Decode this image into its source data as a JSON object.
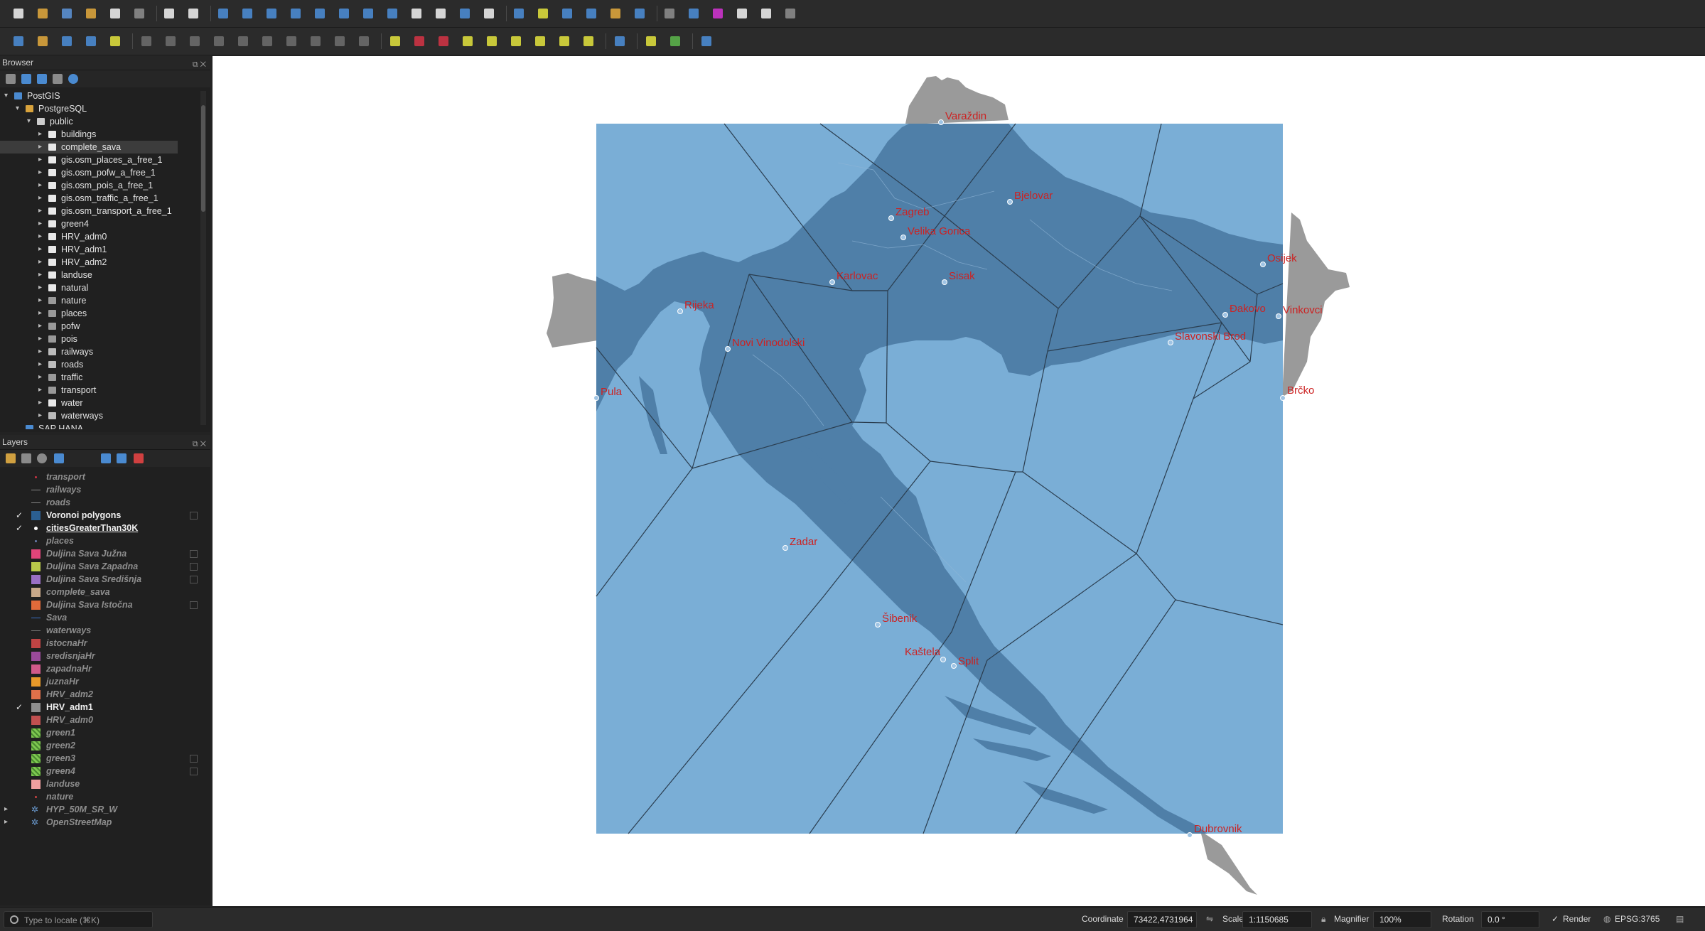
{
  "browser": {
    "title": "Browser",
    "items": [
      {
        "label": "PostGIS"
      },
      {
        "label": "PostgreSQL"
      },
      {
        "label": "public"
      },
      {
        "label": "buildings"
      },
      {
        "label": "complete_sava"
      },
      {
        "label": "gis.osm_places_a_free_1"
      },
      {
        "label": "gis.osm_pofw_a_free_1"
      },
      {
        "label": "gis.osm_pois_a_free_1"
      },
      {
        "label": "gis.osm_traffic_a_free_1"
      },
      {
        "label": "gis.osm_transport_a_free_1"
      },
      {
        "label": "green4"
      },
      {
        "label": "HRV_adm0"
      },
      {
        "label": "HRV_adm1"
      },
      {
        "label": "HRV_adm2"
      },
      {
        "label": "landuse"
      },
      {
        "label": "natural"
      },
      {
        "label": "nature"
      },
      {
        "label": "places"
      },
      {
        "label": "pofw"
      },
      {
        "label": "pois"
      },
      {
        "label": "railways"
      },
      {
        "label": "roads"
      },
      {
        "label": "traffic"
      },
      {
        "label": "transport"
      },
      {
        "label": "water"
      },
      {
        "label": "waterways"
      },
      {
        "label": "SAP HANA"
      }
    ]
  },
  "layers": {
    "title": "Layers",
    "items": [
      {
        "name": "transport",
        "checked": false,
        "color": "#cc3344"
      },
      {
        "name": "railways",
        "checked": false,
        "color": "#888888"
      },
      {
        "name": "roads",
        "checked": false,
        "color": "#888888"
      },
      {
        "name": "Voronoi polygons",
        "checked": true,
        "color": "#2b5f91"
      },
      {
        "name": "citiesGreaterThan30K",
        "checked": true,
        "color": "#ffffff"
      },
      {
        "name": "places",
        "checked": false,
        "color": "#6a7fb0"
      },
      {
        "name": "Duljina Sava Južna",
        "checked": false,
        "color": "#e0457a"
      },
      {
        "name": "Duljina Sava Zapadna",
        "checked": false,
        "color": "#b8c94a"
      },
      {
        "name": "Duljina Sava Središnja",
        "checked": false,
        "color": "#9a6fc4"
      },
      {
        "name": "complete_sava",
        "checked": false,
        "color": "#c8a98a"
      },
      {
        "name": "Duljina Sava Istočna",
        "checked": false,
        "color": "#e06a3a"
      },
      {
        "name": "Sava",
        "checked": false,
        "color": "#3a6fc4"
      },
      {
        "name": "waterways",
        "checked": false,
        "color": "#777777"
      },
      {
        "name": "istocnaHr",
        "checked": false,
        "color": "#c04444"
      },
      {
        "name": "sredisnjaHr",
        "checked": false,
        "color": "#9a4a9a"
      },
      {
        "name": "zapadnaHr",
        "checked": false,
        "color": "#d05a8a"
      },
      {
        "name": "juznaHr",
        "checked": false,
        "color": "#e89a2a"
      },
      {
        "name": "HRV_adm2",
        "checked": false,
        "color": "#e0704a"
      },
      {
        "name": "HRV_adm1",
        "checked": true,
        "color": "#8e8e8e"
      },
      {
        "name": "HRV_adm0",
        "checked": false,
        "color": "#c05050"
      },
      {
        "name": "green1",
        "checked": false,
        "color": "#7ec850"
      },
      {
        "name": "green2",
        "checked": false,
        "color": "#7ec850"
      },
      {
        "name": "green3",
        "checked": false,
        "color": "#7ec850"
      },
      {
        "name": "green4",
        "checked": false,
        "color": "#7ec850"
      },
      {
        "name": "landuse",
        "checked": false,
        "color": "#f0a0a0"
      },
      {
        "name": "nature",
        "checked": false,
        "color": "#cc4444"
      },
      {
        "name": "HYP_50M_SR_W",
        "checked": false,
        "color": "#6a9ad0"
      },
      {
        "name": "OpenStreetMap",
        "checked": false,
        "color": "#6a9ad0"
      }
    ]
  },
  "map": {
    "voronoi_fill": "#7aaed6",
    "land_fill": "#4f7fa8",
    "outside_land": "#9a9a9a",
    "label_color": "#cc2222",
    "cities": [
      "Varaždin",
      "Zagreb",
      "Velika Gorica",
      "Bjelovar",
      "Osijek",
      "Karlovac",
      "Sisak",
      "Rijeka",
      "Novi Vinodolski",
      "Đakovo",
      "Vinkovci",
      "Slavonski Brod",
      "Pula",
      "Brčko",
      "Zadar",
      "Šibenik",
      "Kaštela",
      "Split",
      "Dubrovnik"
    ]
  },
  "status": {
    "locate_placeholder": "Type to locate (⌘K)",
    "coordinate_label": "Coordinate",
    "coordinate_value": "73422,4731964",
    "scale_label": "Scale",
    "scale_value": "1:1150685",
    "magnifier_label": "Magnifier",
    "magnifier_value": "100%",
    "rotation_label": "Rotation",
    "rotation_value": "0.0 °",
    "render_label": "Render",
    "crs_label": "EPSG:3765"
  }
}
